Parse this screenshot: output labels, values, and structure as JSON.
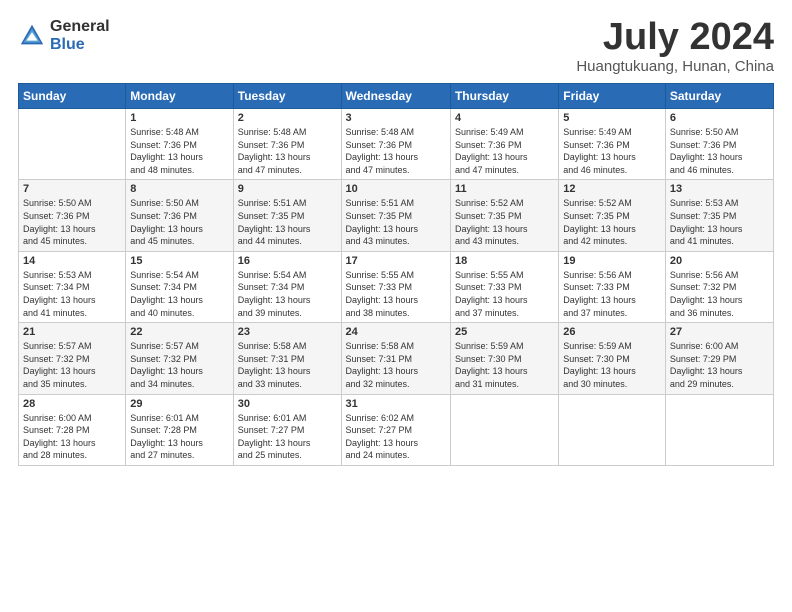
{
  "header": {
    "logo_general": "General",
    "logo_blue": "Blue",
    "month_title": "July 2024",
    "location": "Huangtukuang, Hunan, China"
  },
  "days_of_week": [
    "Sunday",
    "Monday",
    "Tuesday",
    "Wednesday",
    "Thursday",
    "Friday",
    "Saturday"
  ],
  "weeks": [
    [
      {
        "day": "",
        "info": ""
      },
      {
        "day": "1",
        "info": "Sunrise: 5:48 AM\nSunset: 7:36 PM\nDaylight: 13 hours\nand 48 minutes."
      },
      {
        "day": "2",
        "info": "Sunrise: 5:48 AM\nSunset: 7:36 PM\nDaylight: 13 hours\nand 47 minutes."
      },
      {
        "day": "3",
        "info": "Sunrise: 5:48 AM\nSunset: 7:36 PM\nDaylight: 13 hours\nand 47 minutes."
      },
      {
        "day": "4",
        "info": "Sunrise: 5:49 AM\nSunset: 7:36 PM\nDaylight: 13 hours\nand 47 minutes."
      },
      {
        "day": "5",
        "info": "Sunrise: 5:49 AM\nSunset: 7:36 PM\nDaylight: 13 hours\nand 46 minutes."
      },
      {
        "day": "6",
        "info": "Sunrise: 5:50 AM\nSunset: 7:36 PM\nDaylight: 13 hours\nand 46 minutes."
      }
    ],
    [
      {
        "day": "7",
        "info": "Sunrise: 5:50 AM\nSunset: 7:36 PM\nDaylight: 13 hours\nand 45 minutes."
      },
      {
        "day": "8",
        "info": "Sunrise: 5:50 AM\nSunset: 7:36 PM\nDaylight: 13 hours\nand 45 minutes."
      },
      {
        "day": "9",
        "info": "Sunrise: 5:51 AM\nSunset: 7:35 PM\nDaylight: 13 hours\nand 44 minutes."
      },
      {
        "day": "10",
        "info": "Sunrise: 5:51 AM\nSunset: 7:35 PM\nDaylight: 13 hours\nand 43 minutes."
      },
      {
        "day": "11",
        "info": "Sunrise: 5:52 AM\nSunset: 7:35 PM\nDaylight: 13 hours\nand 43 minutes."
      },
      {
        "day": "12",
        "info": "Sunrise: 5:52 AM\nSunset: 7:35 PM\nDaylight: 13 hours\nand 42 minutes."
      },
      {
        "day": "13",
        "info": "Sunrise: 5:53 AM\nSunset: 7:35 PM\nDaylight: 13 hours\nand 41 minutes."
      }
    ],
    [
      {
        "day": "14",
        "info": "Sunrise: 5:53 AM\nSunset: 7:34 PM\nDaylight: 13 hours\nand 41 minutes."
      },
      {
        "day": "15",
        "info": "Sunrise: 5:54 AM\nSunset: 7:34 PM\nDaylight: 13 hours\nand 40 minutes."
      },
      {
        "day": "16",
        "info": "Sunrise: 5:54 AM\nSunset: 7:34 PM\nDaylight: 13 hours\nand 39 minutes."
      },
      {
        "day": "17",
        "info": "Sunrise: 5:55 AM\nSunset: 7:33 PM\nDaylight: 13 hours\nand 38 minutes."
      },
      {
        "day": "18",
        "info": "Sunrise: 5:55 AM\nSunset: 7:33 PM\nDaylight: 13 hours\nand 37 minutes."
      },
      {
        "day": "19",
        "info": "Sunrise: 5:56 AM\nSunset: 7:33 PM\nDaylight: 13 hours\nand 37 minutes."
      },
      {
        "day": "20",
        "info": "Sunrise: 5:56 AM\nSunset: 7:32 PM\nDaylight: 13 hours\nand 36 minutes."
      }
    ],
    [
      {
        "day": "21",
        "info": "Sunrise: 5:57 AM\nSunset: 7:32 PM\nDaylight: 13 hours\nand 35 minutes."
      },
      {
        "day": "22",
        "info": "Sunrise: 5:57 AM\nSunset: 7:32 PM\nDaylight: 13 hours\nand 34 minutes."
      },
      {
        "day": "23",
        "info": "Sunrise: 5:58 AM\nSunset: 7:31 PM\nDaylight: 13 hours\nand 33 minutes."
      },
      {
        "day": "24",
        "info": "Sunrise: 5:58 AM\nSunset: 7:31 PM\nDaylight: 13 hours\nand 32 minutes."
      },
      {
        "day": "25",
        "info": "Sunrise: 5:59 AM\nSunset: 7:30 PM\nDaylight: 13 hours\nand 31 minutes."
      },
      {
        "day": "26",
        "info": "Sunrise: 5:59 AM\nSunset: 7:30 PM\nDaylight: 13 hours\nand 30 minutes."
      },
      {
        "day": "27",
        "info": "Sunrise: 6:00 AM\nSunset: 7:29 PM\nDaylight: 13 hours\nand 29 minutes."
      }
    ],
    [
      {
        "day": "28",
        "info": "Sunrise: 6:00 AM\nSunset: 7:28 PM\nDaylight: 13 hours\nand 28 minutes."
      },
      {
        "day": "29",
        "info": "Sunrise: 6:01 AM\nSunset: 7:28 PM\nDaylight: 13 hours\nand 27 minutes."
      },
      {
        "day": "30",
        "info": "Sunrise: 6:01 AM\nSunset: 7:27 PM\nDaylight: 13 hours\nand 25 minutes."
      },
      {
        "day": "31",
        "info": "Sunrise: 6:02 AM\nSunset: 7:27 PM\nDaylight: 13 hours\nand 24 minutes."
      },
      {
        "day": "",
        "info": ""
      },
      {
        "day": "",
        "info": ""
      },
      {
        "day": "",
        "info": ""
      }
    ]
  ]
}
